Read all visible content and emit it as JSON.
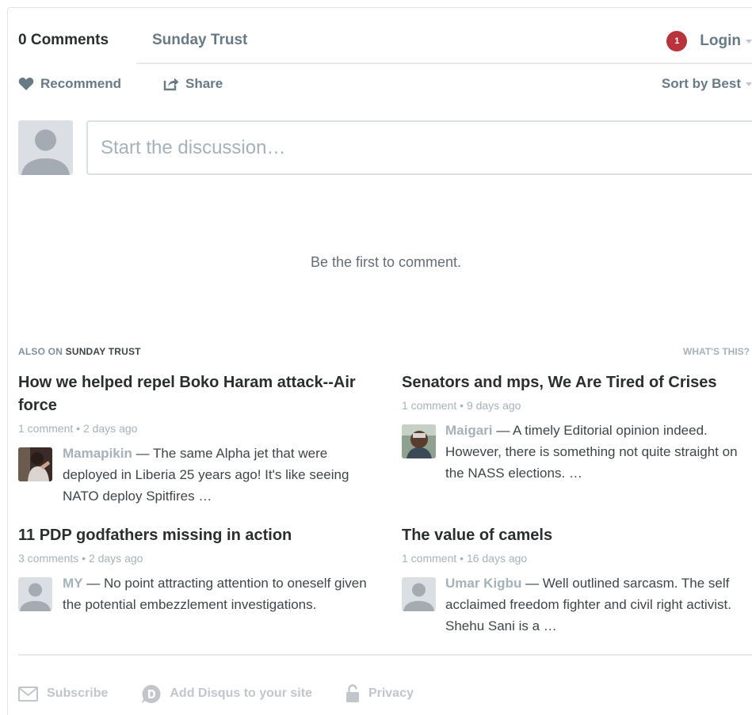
{
  "nav": {
    "comment_count": "0 Comments",
    "site_tab": "Sunday Trust",
    "notification_count": "1",
    "login_label": "Login"
  },
  "actions": {
    "recommend_label": "Recommend",
    "share_label": "Share",
    "sort_label": "Sort by Best"
  },
  "composer": {
    "placeholder": "Start the discussion…"
  },
  "empty_message": "Be the first to comment.",
  "also_on": {
    "prefix": "ALSO ON",
    "site": "SUNDAY TRUST",
    "whats_this": "WHAT'S THIS?"
  },
  "stories": [
    {
      "title": "How we helped repel Boko Haram attack--Air force",
      "comments": "1 comment",
      "age": "2 days ago",
      "author": "Mamapikin",
      "excerpt": "The same Alpha jet that were deployed in Liberia 25 years ago! It's like seeing NATO deploy Spitfires …"
    },
    {
      "title": "Senators and mps, We Are Tired of Crises",
      "comments": "1 comment",
      "age": "9 days ago",
      "author": "Maigari",
      "excerpt": "A timely Editorial opinion indeed. However, there is something not quite straight on the NASS elections. …"
    },
    {
      "title": "11 PDP godfathers missing in action",
      "comments": "3 comments",
      "age": "2 days ago",
      "author": "MY",
      "excerpt": "No point attracting attention to oneself given the potential embezzlement investigations."
    },
    {
      "title": "The value of camels",
      "comments": "1 comment",
      "age": "16 days ago",
      "author": "Umar Kigbu",
      "excerpt": "Well outlined sarcasm. The self acclaimed freedom fighter and civil right activist. Shehu Sani is a …"
    }
  ],
  "footer": {
    "subscribe": "Subscribe",
    "add_disqus": "Add Disqus to your site",
    "privacy": "Privacy"
  },
  "colors": {
    "badge": "#b8333a",
    "muted_link": "#687a86",
    "light_text": "#a5b2b9"
  }
}
